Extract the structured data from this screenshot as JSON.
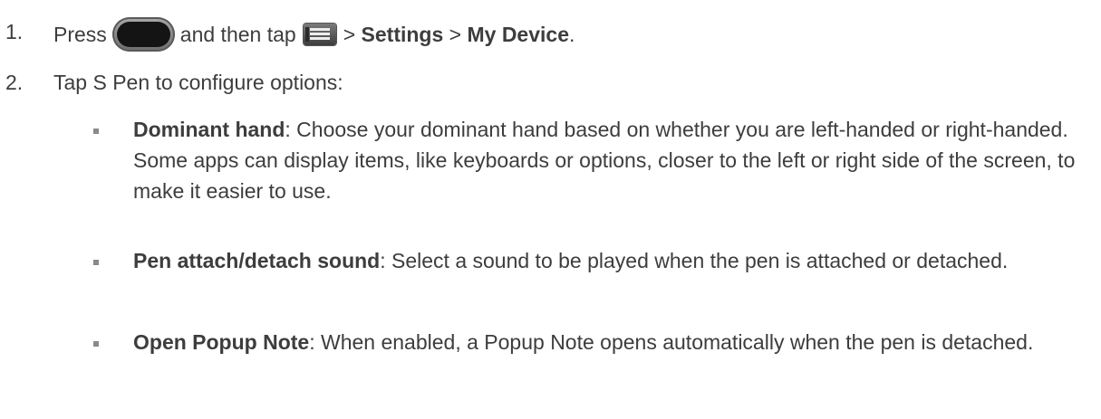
{
  "steps": [
    {
      "number": "1.",
      "press": "Press",
      "home_key_icon": "home-key-icon",
      "and_then_tap": "and then tap",
      "menu_key_icon": "menu-key-icon",
      "sep1": ">",
      "settings": "Settings",
      "sep2": ">",
      "my_device": "My Device",
      "end": "."
    },
    {
      "number": "2.",
      "text": "Tap S Pen to configure options:"
    }
  ],
  "options": [
    {
      "title": "Dominant hand",
      "description": ": Choose your dominant hand based on whether you are left-handed or right-handed. Some apps can display items, like keyboards or options, closer to the left or right side of the screen, to make it easier to use."
    },
    {
      "title": "Pen attach/detach sound",
      "description": ": Select a sound to be played when the pen is attached or detached."
    },
    {
      "title": "Open Popup Note",
      "description": ": When enabled, a Popup Note opens automatically when the pen is detached."
    }
  ]
}
